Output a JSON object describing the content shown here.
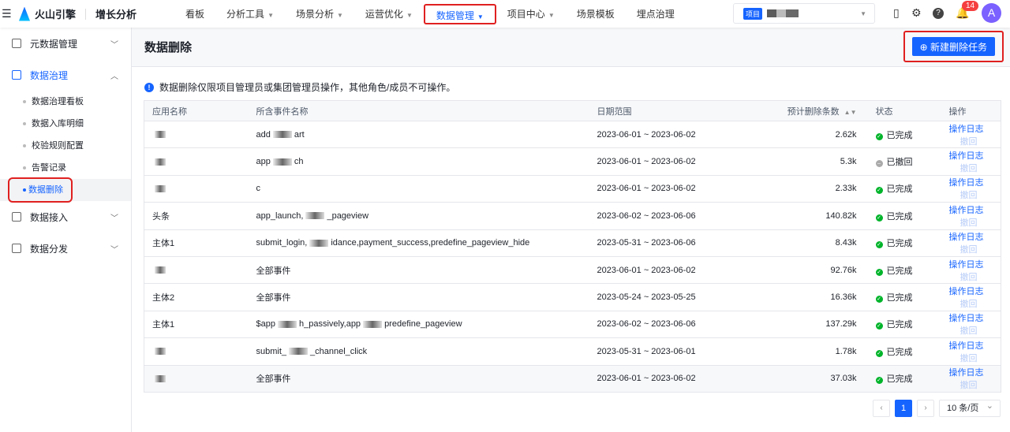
{
  "topbar": {
    "brand": "火山引擎",
    "product": "增长分析",
    "nav": [
      {
        "label": "看板",
        "caret": false
      },
      {
        "label": "分析工具",
        "caret": true
      },
      {
        "label": "场景分析",
        "caret": true
      },
      {
        "label": "运营优化",
        "caret": true
      },
      {
        "label": "数据管理",
        "caret": true,
        "active": true
      },
      {
        "label": "项目中心",
        "caret": true
      },
      {
        "label": "场景模板",
        "caret": false
      },
      {
        "label": "埋点治理",
        "caret": false
      }
    ],
    "project_tag": "项目",
    "notifications": "14",
    "avatar": "A"
  },
  "sidebar": {
    "groups": [
      {
        "label": "元数据管理",
        "open": false
      },
      {
        "label": "数据治理",
        "open": true,
        "items": [
          "数据治理看板",
          "数据入库明细",
          "校验规则配置",
          "告警记录",
          "数据删除"
        ]
      },
      {
        "label": "数据接入",
        "open": false
      },
      {
        "label": "数据分发",
        "open": false
      }
    ]
  },
  "main": {
    "title": "数据删除",
    "new_button": "新建删除任务",
    "notice": "数据删除仅限项目管理员或集团管理员操作，其他角色/成员不可操作。",
    "columns": [
      "应用名称",
      "所含事件名称",
      "日期范围",
      "预计删除条数",
      "状态",
      "操作"
    ],
    "rows": [
      {
        "app": "",
        "events": [
          "add",
          "art"
        ],
        "range": "2023-06-01 ~ 2023-06-02",
        "count": "2.62k",
        "status": "已完成"
      },
      {
        "app": "",
        "events": [
          "app",
          "ch"
        ],
        "range": "2023-06-01 ~ 2023-06-02",
        "count": "5.3k",
        "status": "已撤回"
      },
      {
        "app": "",
        "events": [
          "c"
        ],
        "range": "2023-06-01 ~ 2023-06-02",
        "count": "2.33k",
        "status": "已完成"
      },
      {
        "app": "头条",
        "events": [
          "app_launch,",
          "_pageview"
        ],
        "range": "2023-06-02 ~ 2023-06-06",
        "count": "140.82k",
        "status": "已完成"
      },
      {
        "app": "主体1",
        "events": [
          "submit_login,",
          "idance,payment_success,predefine_pageview_hide"
        ],
        "range": "2023-05-31 ~ 2023-06-06",
        "count": "8.43k",
        "status": "已完成"
      },
      {
        "app": "",
        "events": [
          "全部事件"
        ],
        "range": "2023-06-01 ~ 2023-06-02",
        "count": "92.76k",
        "status": "已完成"
      },
      {
        "app": "主体2",
        "events": [
          "全部事件"
        ],
        "range": "2023-05-24 ~ 2023-05-25",
        "count": "16.36k",
        "status": "已完成"
      },
      {
        "app": "主体1",
        "events": [
          "$app",
          "h_passively,app",
          "predefine_pageview"
        ],
        "range": "2023-06-02 ~ 2023-06-06",
        "count": "137.29k",
        "status": "已完成"
      },
      {
        "app": "",
        "events": [
          "submit_",
          "_channel_click"
        ],
        "range": "2023-05-31 ~ 2023-06-01",
        "count": "1.78k",
        "status": "已完成"
      },
      {
        "app": "",
        "events": [
          "全部事件"
        ],
        "range": "2023-06-01 ~ 2023-06-02",
        "count": "37.03k",
        "status": "已完成"
      }
    ],
    "log_label": "操作日志",
    "revoke_label": "撤回",
    "pagination": {
      "current": "1",
      "prev": "‹",
      "next": "›",
      "page_size": "10 条/页"
    }
  }
}
